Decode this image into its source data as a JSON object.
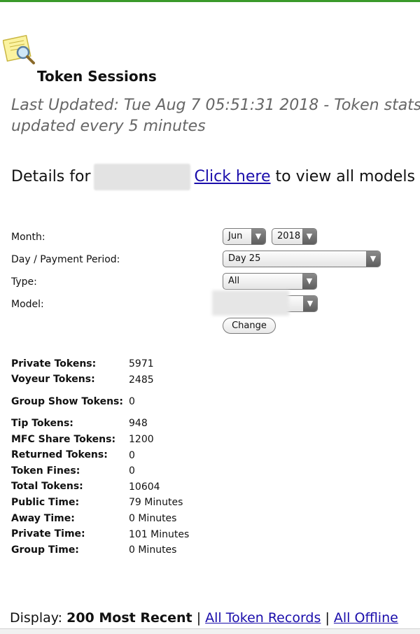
{
  "header": {
    "title": "Token Sessions",
    "last_updated": "Last Updated: Tue Aug 7 05:51:31 2018 - Token stats",
    "update_note": "updated every 5 minutes"
  },
  "details": {
    "prefix": "Details for",
    "link_text": "Click here",
    "suffix": "to view all models"
  },
  "form": {
    "month_label": "Month:",
    "month_value": "Jun",
    "year_value": "2018",
    "day_label": "Day / Payment Period:",
    "day_value": "Day 25",
    "type_label": "Type:",
    "type_value": "All",
    "model_label": "Model:",
    "change_button": "Change"
  },
  "stats": [
    {
      "label": "Private Tokens:",
      "value": "5971"
    },
    {
      "label": "Voyeur Tokens:",
      "value": "2485"
    },
    {
      "label": "Group Show Tokens:",
      "value": "0"
    },
    {
      "label": "Tip Tokens:",
      "value": "948"
    },
    {
      "label": "MFC Share Tokens:",
      "value": "1200"
    },
    {
      "label": "Returned Tokens:",
      "value": "0"
    },
    {
      "label": "Token Fines:",
      "value": "0"
    },
    {
      "label": "Total Tokens:",
      "value": "10604"
    },
    {
      "label": "Public Time:",
      "value": "79 Minutes"
    },
    {
      "label": "Away Time:",
      "value": "0 Minutes"
    },
    {
      "label": "Private Time:",
      "value": "101 Minutes"
    },
    {
      "label": "Group Time:",
      "value": "0 Minutes"
    }
  ],
  "display": {
    "prefix": "Display:",
    "current": "200 Most Recent",
    "sep": "|",
    "link1": "All Token Records",
    "link2": "All Offline"
  },
  "colors": {
    "accent_bar": "#3a9a2a",
    "link": "#1a0dab"
  },
  "icons": {
    "logo": "magnifier-note-icon",
    "dropdown": "triangle-down-icon"
  }
}
